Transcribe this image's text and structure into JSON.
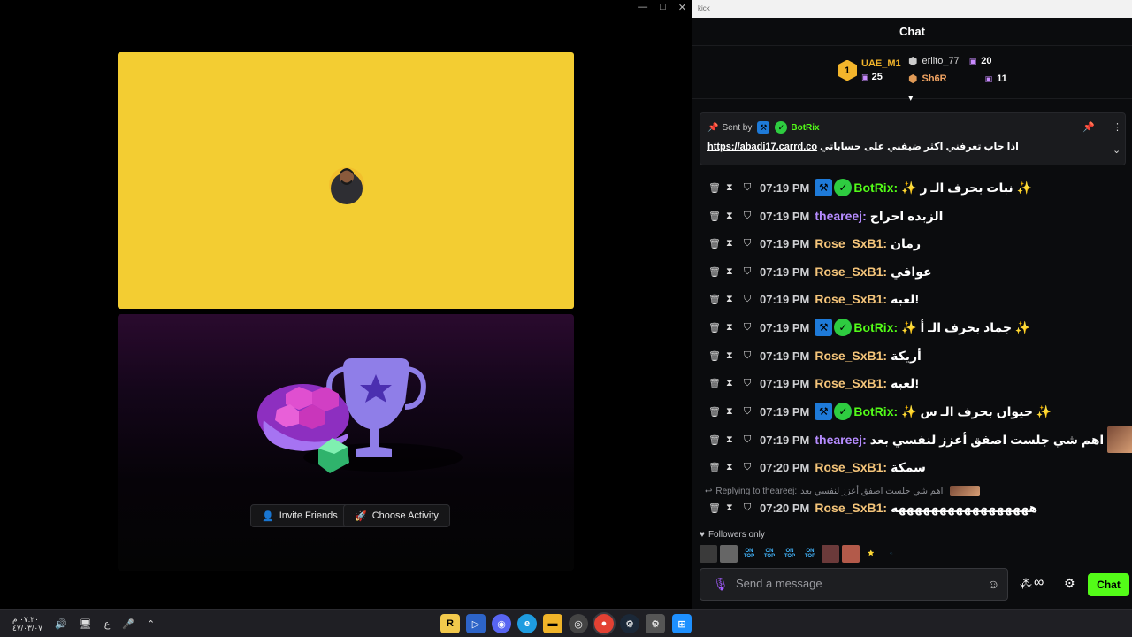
{
  "left_window": {
    "controls": [
      "—",
      "□",
      "✕"
    ],
    "invite_label": "Invite Friends",
    "choose_label": "Choose Activity"
  },
  "chat_window": {
    "titlebar": "kick",
    "title": "Chat",
    "leaderboard": {
      "first": {
        "rank": "1",
        "name": "UAE_M1",
        "count": "25"
      },
      "second": {
        "name": "eriito_77",
        "count": "20"
      },
      "third": {
        "name": "Sh6R",
        "count": "11"
      }
    },
    "pinned": {
      "sent_by": "Sent by",
      "sender": "BotRix",
      "message": "اذا حاب تعرفني اكثر ضيفني على حساباتي",
      "link": "https://abadi17.carrd.co"
    },
    "messages": [
      {
        "time": "07:19 PM",
        "user": "BotRix:",
        "color": "#53fc18",
        "bot": true,
        "text": "✨ نبات بحرف الـ ر ✨"
      },
      {
        "time": "07:19 PM",
        "user": "theareej:",
        "color": "#b68cff",
        "bot": false,
        "text": "الزبده احراج"
      },
      {
        "time": "07:19 PM",
        "user": "Rose_SxB1:",
        "color": "#f5c57a",
        "bot": false,
        "text": "رمان"
      },
      {
        "time": "07:19 PM",
        "user": "Rose_SxB1:",
        "color": "#f5c57a",
        "bot": false,
        "text": "عوافي"
      },
      {
        "time": "07:19 PM",
        "user": "Rose_SxB1:",
        "color": "#f5c57a",
        "bot": false,
        "text": "لعبه!"
      },
      {
        "time": "07:19 PM",
        "user": "BotRix:",
        "color": "#53fc18",
        "bot": true,
        "text": "✨ جماد بحرف الـ أ ✨"
      },
      {
        "time": "07:19 PM",
        "user": "Rose_SxB1:",
        "color": "#f5c57a",
        "bot": false,
        "text": "أريكة"
      },
      {
        "time": "07:19 PM",
        "user": "Rose_SxB1:",
        "color": "#f5c57a",
        "bot": false,
        "text": "لعبه!"
      },
      {
        "time": "07:19 PM",
        "user": "BotRix:",
        "color": "#53fc18",
        "bot": true,
        "text": "✨ حيوان بحرف الـ س ✨"
      },
      {
        "time": "07:19 PM",
        "user": "theareej:",
        "color": "#b68cff",
        "bot": false,
        "text": "اهم شي جلست اصفق أعزز لنفسي بعد",
        "emote": true
      },
      {
        "time": "07:20 PM",
        "user": "Rose_SxB1:",
        "color": "#f5c57a",
        "bot": false,
        "text": "سمكة"
      },
      {
        "time": "07:20 PM",
        "user": "Rose_SxB1:",
        "color": "#f5c57a",
        "bot": false,
        "text": "هههههههههههههههههه"
      }
    ],
    "reply_context": {
      "label": "Replying to theareej:",
      "text": "اهم شي جلست اصفق أعزز لنفسي بعد"
    },
    "followers_label": "Followers only",
    "emotes": [
      {
        "label": "",
        "bg": "#3a3a3a"
      },
      {
        "label": "",
        "bg": "#666"
      },
      {
        "label": "ON TOP",
        "bg": "transparent"
      },
      {
        "label": "ON TOP",
        "bg": "transparent"
      },
      {
        "label": "ON TOP",
        "bg": "transparent"
      },
      {
        "label": "ON TOP",
        "bg": "transparent"
      },
      {
        "label": "",
        "bg": "#6b3a3a"
      },
      {
        "label": "",
        "bg": "#b35a4a"
      },
      {
        "label": "⭐",
        "bg": "transparent"
      },
      {
        "label": "◐",
        "bg": "transparent"
      }
    ],
    "input_placeholder": "Send a message",
    "send_label": "Chat"
  },
  "taskbar": {
    "time": "٠٧:٢٠ م",
    "date": "٤٧/٠٣/٠٧",
    "lang": "ع"
  },
  "colors": {
    "kick_green": "#53fc18",
    "stage_yellow": "#f3cd32",
    "rose_name": "#f5c57a",
    "theareej_name": "#b68cff"
  }
}
